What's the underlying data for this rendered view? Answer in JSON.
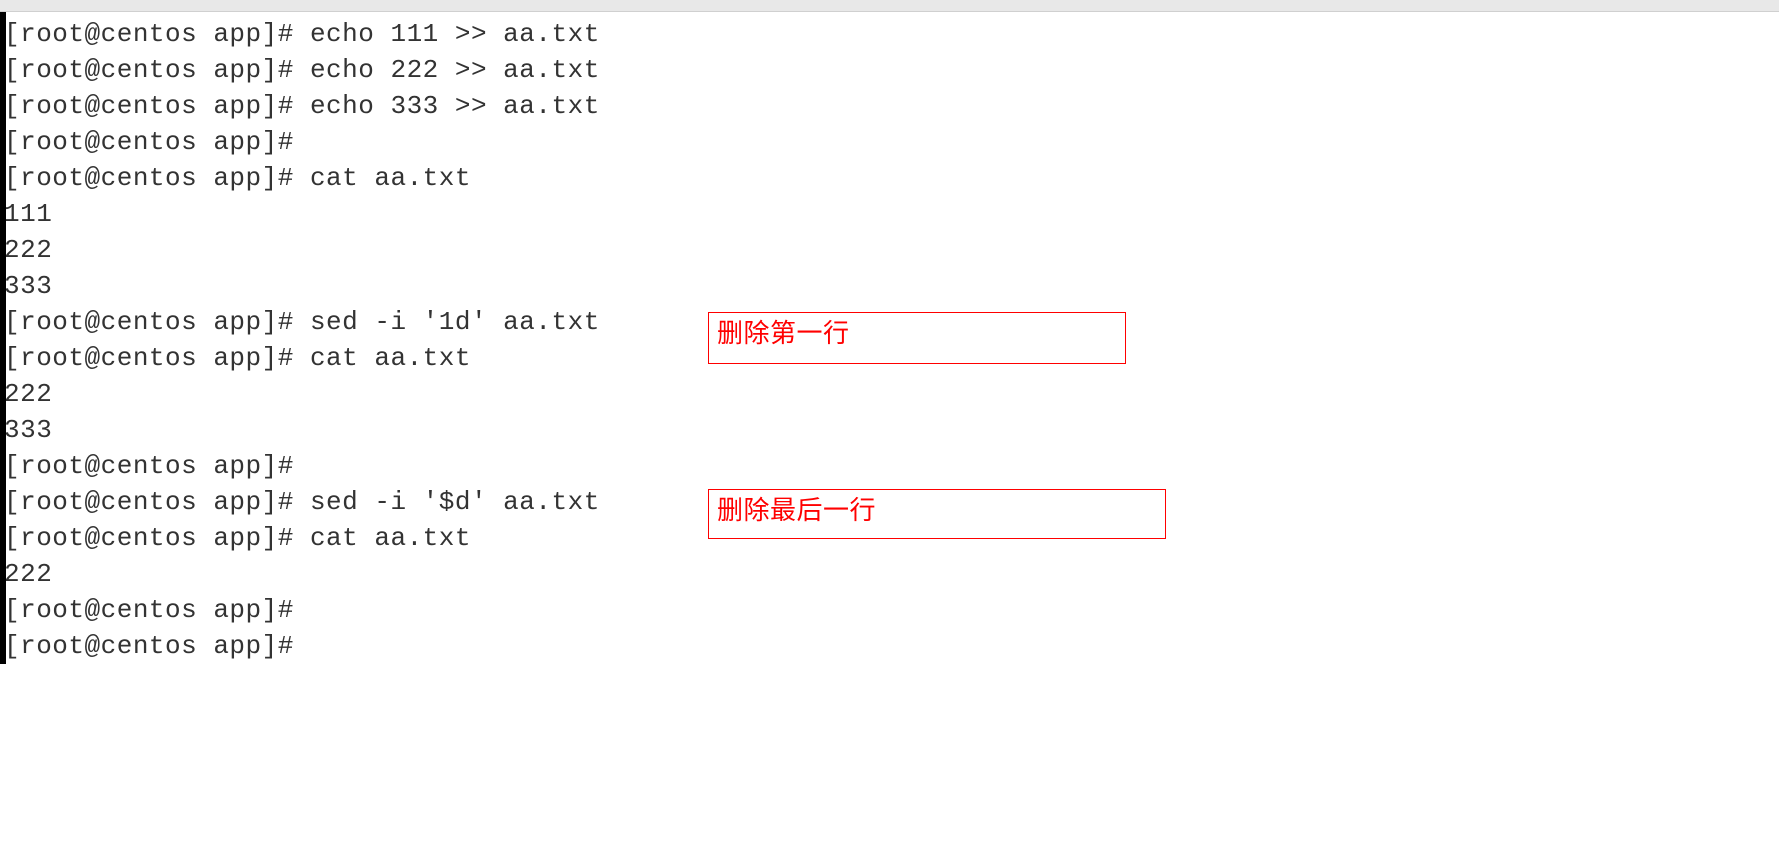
{
  "prompt": "[root@centos app]# ",
  "lines": {
    "l0": "[root@centos app]# echo 111 >> aa.txt",
    "l1": "[root@centos app]# echo 222 >> aa.txt",
    "l2": "[root@centos app]# echo 333 >> aa.txt",
    "l3": "[root@centos app]# ",
    "l4": "[root@centos app]# cat aa.txt",
    "l5": "111",
    "l6": "222",
    "l7": "333",
    "l8": "[root@centos app]# sed -i '1d' aa.txt",
    "l9": "[root@centos app]# cat aa.txt",
    "l10": "222",
    "l11": "333",
    "l12": "[root@centos app]# ",
    "l13": "[root@centos app]# sed -i '$d' aa.txt",
    "l14": "[root@centos app]# cat aa.txt",
    "l15": "222",
    "l16": "[root@centos app]# ",
    "l17": "[root@centos app]# "
  },
  "annotations": {
    "a1": "删除第一行",
    "a2": "删除最后一行"
  }
}
